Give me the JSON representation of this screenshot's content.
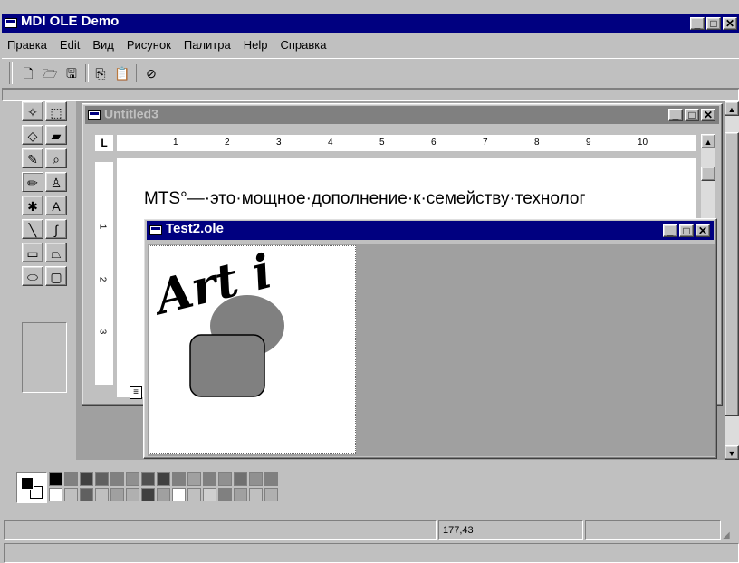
{
  "app": {
    "title": "MDI OLE Demo",
    "menu": [
      {
        "label": "Правка"
      },
      {
        "label": "Edit"
      },
      {
        "label": "Вид"
      },
      {
        "label": "Рисунок"
      },
      {
        "label": "Палитра"
      },
      {
        "label": "Help"
      },
      {
        "label": "Справка"
      }
    ]
  },
  "toolbar": {
    "buttons": [
      {
        "icon": "new-document-icon",
        "glyph": "🗋"
      },
      {
        "icon": "open-folder-icon",
        "glyph": "🗁"
      },
      {
        "icon": "save-icon",
        "glyph": "🖫"
      },
      {
        "icon": "copy-icon",
        "glyph": "⎘"
      },
      {
        "icon": "paste-icon",
        "glyph": "📋"
      },
      {
        "icon": "disabled-icon",
        "glyph": "⊘"
      }
    ]
  },
  "doc": {
    "title": "Untitled3",
    "body_text": "MTS°—·это·мощное·дополнение·к·семейству·технолог",
    "ruler_numbers": [
      "1",
      "2",
      "3",
      "4",
      "5",
      "6",
      "7",
      "8",
      "9",
      "10"
    ],
    "ruler_tab_glyph": "L",
    "vruler_numbers": [
      "1",
      "2",
      "3"
    ]
  },
  "ole": {
    "title": "Test2.ole",
    "art_text": "Art i",
    "colors": {
      "shape": "#808080",
      "bg": "#a0a0a0"
    }
  },
  "palette": {
    "foreground": "#000000",
    "background": "#ffffff",
    "row1": [
      "#000000",
      "#808080",
      "#404040",
      "#606060",
      "#808080",
      "#909090",
      "#505050",
      "#404040",
      "#808080",
      "#a0a0a0",
      "#808080",
      "#909090",
      "#707070",
      "#909090",
      "#808080"
    ],
    "row2": [
      "#ffffff",
      "#c0c0c0",
      "#606060",
      "#c0c0c0",
      "#a0a0a0",
      "#b0b0b0",
      "#404040",
      "#a0a0a0",
      "#ffffff",
      "#c0c0c0",
      "#d0d0d0",
      "#808080",
      "#a0a0a0",
      "#c0c0c0",
      "#b0b0b0"
    ]
  },
  "status": {
    "coords": "177,43"
  },
  "tools": [
    "select-free-icon",
    "select-rect-icon",
    "eraser-icon",
    "fill-icon",
    "picker-icon",
    "zoom-icon",
    "pencil-icon",
    "brush-icon",
    "airbrush-icon",
    "text-icon",
    "line-icon",
    "curve-icon",
    "rectangle-icon",
    "polygon-icon",
    "ellipse-icon",
    "rounded-rect-icon"
  ],
  "tool_glyphs": [
    "✧",
    "⬚",
    "◇",
    "▰",
    "✎",
    "⌕",
    "✏",
    "♙",
    "✱",
    "A",
    "╲",
    "∫",
    "▭",
    "⏢",
    "⬭",
    "▢"
  ]
}
